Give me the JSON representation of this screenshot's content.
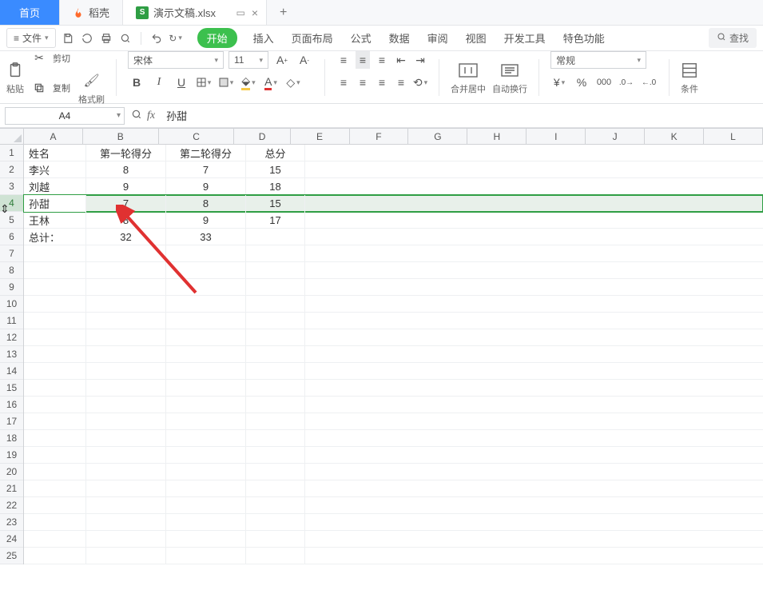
{
  "tabs": {
    "home": "首页",
    "docell": "稻壳",
    "doc": "演示文稿.xlsx",
    "new": "+"
  },
  "file_btn": "文件",
  "ribbon_tabs": {
    "start": "开始",
    "insert": "插入",
    "layout": "页面布局",
    "formula": "公式",
    "data": "数据",
    "review": "审阅",
    "view": "视图",
    "dev": "开发工具",
    "special": "特色功能"
  },
  "search_label": "查找",
  "clip": {
    "paste": "粘贴",
    "cut": "剪切",
    "copy": "复制",
    "painter": "格式刷"
  },
  "font": {
    "name": "宋体",
    "size": "11"
  },
  "mergegrp": {
    "merge": "合并居中",
    "wrap": "自动换行"
  },
  "numfmt": "常规",
  "cond_label": "条件",
  "namebox": "A4",
  "formula_value": "孙甜",
  "chart_data": {
    "type": "table",
    "columns": [
      "A",
      "B",
      "C",
      "D",
      "E",
      "F",
      "G",
      "H",
      "I",
      "J",
      "K",
      "L"
    ],
    "headers_row": {
      "A": "姓名",
      "B": "第一轮得分",
      "C": "第二轮得分",
      "D": "总分"
    },
    "rows": [
      {
        "A": "李兴",
        "B": "8",
        "C": "7",
        "D": "15"
      },
      {
        "A": "刘越",
        "B": "9",
        "C": "9",
        "D": "18"
      },
      {
        "A": "孙甜",
        "B": "7",
        "C": "8",
        "D": "15"
      },
      {
        "A": "王林",
        "B": "8",
        "C": "9",
        "D": "17"
      },
      {
        "A": "总计：",
        "B": "32",
        "C": "33",
        "D": ""
      }
    ],
    "row_labels": [
      "1",
      "2",
      "3",
      "4",
      "5",
      "6",
      "7",
      "8",
      "9",
      "10",
      "11",
      "12",
      "13",
      "14",
      "15",
      "16",
      "17",
      "18",
      "19",
      "20",
      "21",
      "22",
      "23",
      "24",
      "25"
    ],
    "selected_row": 4
  },
  "colw": {
    "A": 78,
    "B": 100,
    "C": 100,
    "D": 74,
    "other": 78
  }
}
